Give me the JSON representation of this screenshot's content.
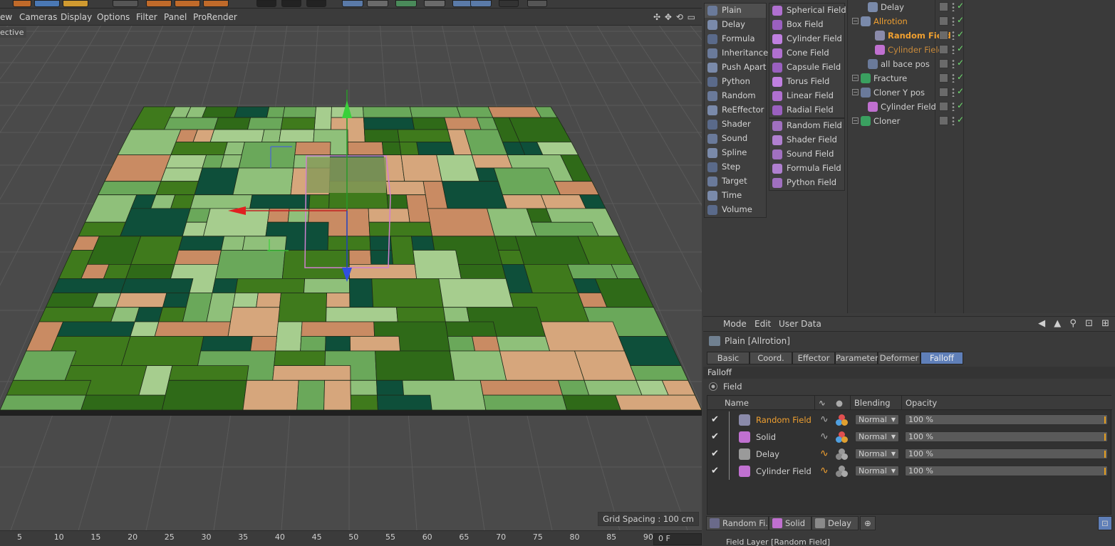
{
  "viewport_menu": [
    "ew",
    "Cameras",
    "Display",
    "Options",
    "Filter",
    "Panel",
    "ProRender"
  ],
  "viewport": {
    "camera_label": "ective",
    "grid_spacing": "Grid Spacing : 100 cm",
    "nav_icons": "✣ ✥ ⟲ ▭"
  },
  "timeline": {
    "ticks": [
      "5",
      "10",
      "15",
      "20",
      "25",
      "30",
      "35",
      "40",
      "45",
      "50",
      "55",
      "60",
      "65",
      "70",
      "75",
      "80",
      "85",
      "90"
    ],
    "frame": "0 F"
  },
  "effector_menu": {
    "items": [
      "Plain",
      "Delay",
      "Formula",
      "Inheritance",
      "Push Apart",
      "Python",
      "Random",
      "ReEffector",
      "Shader",
      "Sound",
      "Spline",
      "Step",
      "Target",
      "Time",
      "Volume"
    ]
  },
  "field_menu": {
    "group1": [
      "Spherical Field",
      "Box Field",
      "Cylinder Field",
      "Cone Field",
      "Capsule Field",
      "Torus Field",
      "Linear Field",
      "Radial Field"
    ],
    "group2": [
      "Random Field",
      "Shader Field",
      "Sound Field",
      "Formula Field",
      "Python Field"
    ]
  },
  "object_manager": {
    "rows": [
      {
        "name": "Delay",
        "color": "#cfcfcf"
      },
      {
        "name": "Allrotion",
        "color": "#f0a030"
      },
      {
        "name": "Random Field",
        "color": "#f0a030"
      },
      {
        "name": "Cylinder Field",
        "color": "#c98a3a"
      },
      {
        "name": "all bace pos",
        "color": "#cfcfcf"
      },
      {
        "name": "Fracture",
        "color": "#cfcfcf"
      },
      {
        "name": "Cloner Y pos",
        "color": "#cfcfcf"
      },
      {
        "name": "Cylinder Field",
        "color": "#cfcfcf"
      },
      {
        "name": "Cloner",
        "color": "#cfcfcf"
      }
    ]
  },
  "attribute_manager": {
    "menu": [
      "Mode",
      "Edit",
      "User Data"
    ],
    "title": "Plain [Allrotion]",
    "tabs": [
      "Basic",
      "Coord.",
      "Effector",
      "Parameter",
      "Deformer",
      "Falloff"
    ],
    "active_tab": "Falloff",
    "section": "Falloff",
    "field_label": "Field",
    "columns": {
      "name": "Name",
      "blending": "Blending",
      "opacity": "Opacity"
    },
    "field_rows": [
      {
        "name": "Random Field",
        "blending": "Normal",
        "opacity": "100 %",
        "color": "#f0a030"
      },
      {
        "name": "Solid",
        "blending": "Normal",
        "opacity": "100 %",
        "color": "#cfcfcf"
      },
      {
        "name": "Delay",
        "blending": "Normal",
        "opacity": "100 %",
        "color": "#cfcfcf"
      },
      {
        "name": "Cylinder Field",
        "blending": "Normal",
        "opacity": "100 %",
        "color": "#cfcfcf"
      }
    ],
    "bottom_tabs": [
      "Random Fi...",
      "Solid",
      "Delay"
    ],
    "footer": "Field Layer [Random Field]"
  },
  "colors": {
    "accent": "#f0a030",
    "active_tab": "#5f7fb8",
    "check": "#6ee06e"
  }
}
